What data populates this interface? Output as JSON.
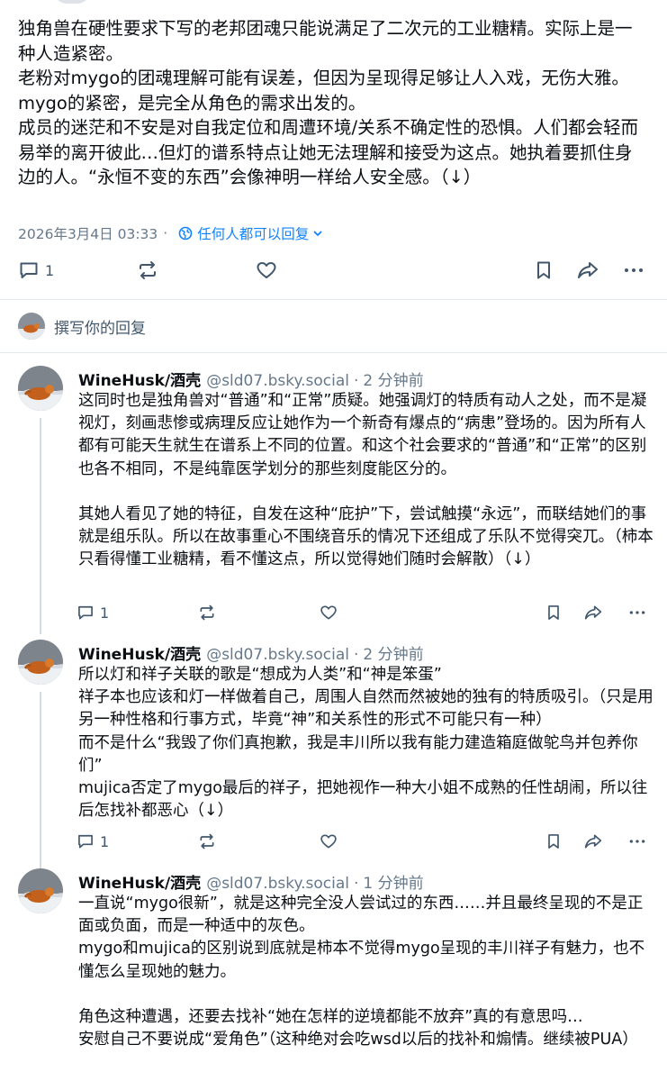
{
  "main_post": {
    "paragraphs": [
      "独角兽在硬性要求下写的老邦团魂只能说满足了二次元的工业糖精。实际上是一种人造紧密。",
      "老粉对mygo的团魂理解可能有误差，但因为呈现得足够让人入戏，无伤大雅。",
      "mygo的紧密，是完全从角色的需求出发的。",
      "成员的迷茫和不安是对自我定位和周遭环境/关系不确定性的恐惧。人们都会轻而易举的离开彼此…但灯的谱系特点让她无法理解和接受为这点。她执着要抓住身边的人。“永恒不变的东西”会像神明一样给人安全感。（↓）"
    ],
    "date": "2026年3月4日 03:33",
    "reply_permission": "任何人都可以回复",
    "reply_count": "1"
  },
  "compose": {
    "placeholder": "撰写你的回复"
  },
  "replies": [
    {
      "author": "WineHusk/酒壳",
      "handle": "@sld07.bsky.social",
      "time": "2 分钟前",
      "paragraphs": [
        "这同时也是独角兽对“普通”和“正常”质疑。她强调灯的特质有动人之处，而不是凝视灯，刻画悲惨或病理反应让她作为一个新奇有爆点的“病患”登场的。因为所有人都有可能天生就生在谱系上不同的位置。和这个社会要求的“普通”和“正常”的区别也各不相同，不是纯靠医学划分的那些刻度能区分的。",
        "",
        "其她人看见了她的特征，自发在这种“庇护”下，尝试触摸“永远”，而联结她们的事就是组乐队。所以在故事重心不围绕音乐的情况下还组成了乐队不觉得突兀。（柿本只看得懂工业糖精，看不懂这点，所以觉得她们随时会解散）（↓）"
      ],
      "reply_count": "1"
    },
    {
      "author": "WineHusk/酒壳",
      "handle": "@sld07.bsky.social",
      "time": "2 分钟前",
      "paragraphs": [
        "所以灯和祥子关联的歌是“想成为人类”和“神是笨蛋”",
        "祥子本也应该和灯一样做着自己，周围人自然而然被她的独有的特质吸引。（只是用另一种性格和行事方式，毕竟“神”和关系性的形式不可能只有一种）",
        "而不是什么“我毁了你们真抱歉，我是丰川所以我有能力建造箱庭做鸵鸟并包养你们”",
        "mujica否定了mygo最后的祥子，把她视作一种大小姐不成熟的任性胡闹，所以往后怎找补都恶心（↓）"
      ],
      "reply_count": "1"
    },
    {
      "author": "WineHusk/酒壳",
      "handle": "@sld07.bsky.social",
      "time": "1 分钟前",
      "paragraphs": [
        "一直说“mygo很新”，就是这种完全没人尝试过的东西……并且最终呈现的不是正面或负面，而是一种适中的灰色。",
        "mygo和mujica的区别说到底就是柿本不觉得mygo呈现的丰川祥子有魅力，也不懂怎么呈现她的魅力。",
        "",
        "角色这种遭遇，还要去找补“她在怎样的逆境都能不放弃”真的有意思吗…",
        "安慰自己不要说成“爱角色”（这种绝对会吃wsd以后的找补和煽情。继续被PUA）"
      ]
    }
  ],
  "icons": {
    "reply": "reply-icon",
    "repost": "repost-icon",
    "like": "heart-icon",
    "bookmark": "bookmark-icon",
    "share": "share-icon",
    "more": "more-icon",
    "permission": "globe-icon"
  },
  "colors": {
    "accent": "#1083fe",
    "muted": "#66788a",
    "divider": "#e3e8ed"
  }
}
